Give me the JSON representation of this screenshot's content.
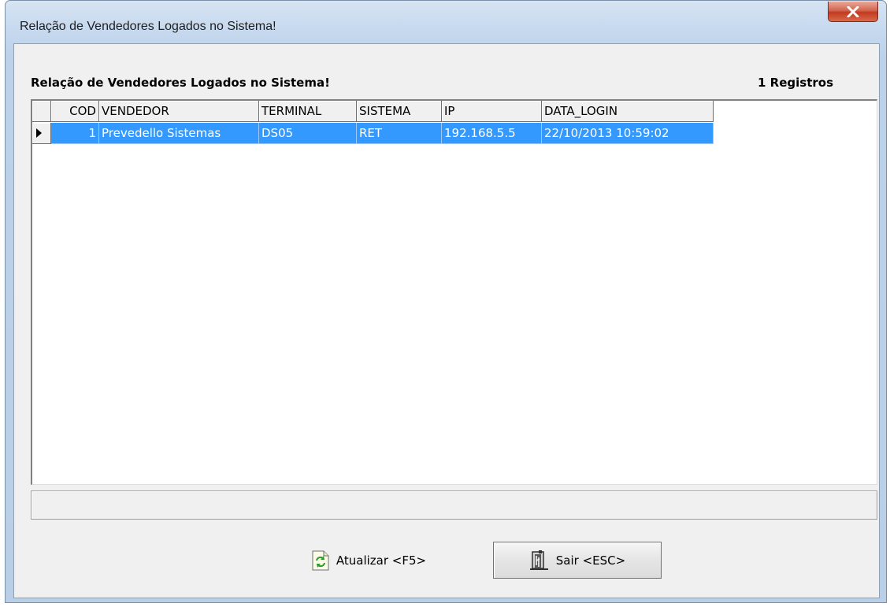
{
  "window": {
    "title": "Relação de Vendedores Logados no Sistema!"
  },
  "panel": {
    "title": "Relação de Vendedores Logados no Sistema!",
    "records": "1 Registros"
  },
  "grid": {
    "columns": [
      "COD",
      "VENDEDOR",
      "TERMINAL",
      "SISTEMA",
      "IP",
      "DATA_LOGIN"
    ],
    "rows": [
      [
        "1",
        "Prevedello Sistemas",
        "DS05",
        "RET",
        "192.168.5.5",
        "22/10/2013 10:59:02"
      ]
    ]
  },
  "status_bar": {
    "text": ""
  },
  "buttons": {
    "refresh": "Atualizar <F5>",
    "exit": "Sair <ESC>"
  },
  "icons": {
    "close": "close-icon",
    "row_pointer": "row-pointer-icon",
    "refresh": "refresh-icon",
    "exit": "exit-door-icon"
  },
  "colors": {
    "selection": "#3399ff",
    "close_button": "#c33a20"
  }
}
